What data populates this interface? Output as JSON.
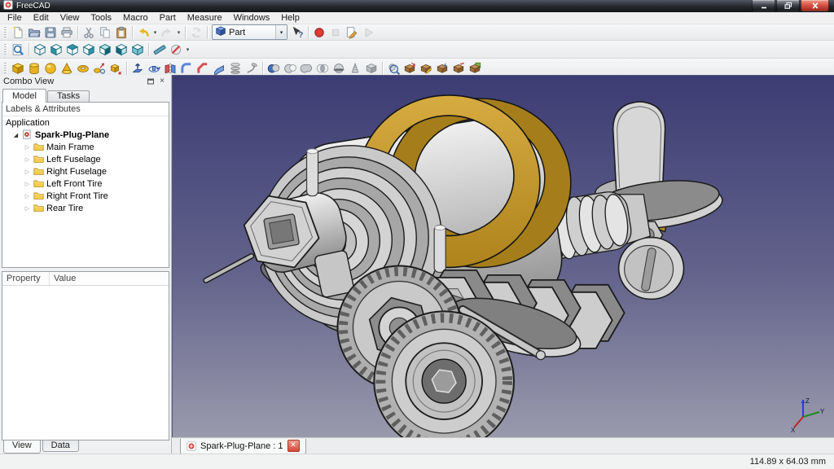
{
  "window": {
    "title": "FreeCAD",
    "controls": {
      "minimize": "minimize",
      "restore": "restore",
      "close": "close"
    }
  },
  "menu_bar": {
    "items": [
      "File",
      "Edit",
      "View",
      "Tools",
      "Macro",
      "Part",
      "Measure",
      "Windows",
      "Help"
    ]
  },
  "workbench_selector": {
    "value": "Part",
    "icon": "workbench-part"
  },
  "toolbars": {
    "standard": [
      [
        {
          "icon": "new-file"
        },
        {
          "icon": "open-file"
        },
        {
          "icon": "save-file"
        },
        {
          "icon": "print"
        }
      ],
      [
        {
          "icon": "cut"
        },
        {
          "icon": "copy"
        },
        {
          "icon": "paste"
        }
      ],
      [
        {
          "icon": "undo",
          "caret": true
        },
        {
          "icon": "redo",
          "caret": true,
          "disabled": true
        }
      ],
      [
        {
          "icon": "refresh",
          "disabled": true
        }
      ],
      [
        {
          "combo": true,
          "icon": "workbench-part"
        },
        {
          "icon": "whats-this"
        }
      ],
      [
        {
          "icon": "record-macro"
        },
        {
          "icon": "stop-macro",
          "disabled": true
        },
        {
          "icon": "edit-macro"
        },
        {
          "icon": "run-macro",
          "disabled": true
        }
      ]
    ],
    "view": [
      [
        {
          "icon": "fit-all"
        }
      ],
      [
        {
          "icon": "view-axonometric"
        },
        {
          "icon": "view-front"
        },
        {
          "icon": "view-top"
        },
        {
          "icon": "view-right"
        },
        {
          "icon": "view-rear"
        },
        {
          "icon": "view-bottom"
        },
        {
          "icon": "view-left"
        }
      ],
      [
        {
          "icon": "measure-distance"
        },
        {
          "icon": "clear-measurement",
          "caret": true
        }
      ]
    ],
    "part": [
      [
        {
          "icon": "primitive-box"
        },
        {
          "icon": "primitive-cylinder"
        },
        {
          "icon": "primitive-sphere"
        },
        {
          "icon": "primitive-cone"
        },
        {
          "icon": "primitive-torus"
        },
        {
          "icon": "create-primitives"
        },
        {
          "icon": "shape-builder"
        }
      ],
      [
        {
          "icon": "extrude"
        },
        {
          "icon": "revolve"
        },
        {
          "icon": "mirror"
        },
        {
          "icon": "fillet"
        },
        {
          "icon": "chamfer"
        },
        {
          "icon": "ruled-surface"
        },
        {
          "icon": "loft"
        },
        {
          "icon": "sweep"
        }
      ],
      [
        {
          "icon": "boolean"
        },
        {
          "icon": "boolean-cut"
        },
        {
          "icon": "boolean-union"
        },
        {
          "icon": "boolean-intersection"
        },
        {
          "icon": "section"
        },
        {
          "icon": "cross-sections"
        },
        {
          "icon": "compound"
        }
      ],
      [
        {
          "icon": "check-geometry"
        },
        {
          "icon": "defeaturing"
        },
        {
          "icon": "edit-shape"
        },
        {
          "icon": "refine-shape"
        },
        {
          "icon": "reverse-shapes"
        },
        {
          "icon": "convert-to-solid"
        }
      ]
    ]
  },
  "combo_view": {
    "title": "Combo View",
    "tabs": [
      {
        "label": "Model",
        "active": true
      },
      {
        "label": "Tasks",
        "active": false
      }
    ],
    "tree_header": "Labels & Attributes",
    "tree": {
      "root": "Application",
      "document": {
        "label": "Spark-Plug-Plane",
        "children": [
          "Main Frame",
          "Left Fuselage",
          "Right Fuselage",
          "Left Front Tire",
          "Right Front Tire",
          "Rear Tire"
        ]
      }
    },
    "property_table": {
      "columns": [
        "Property",
        "Value"
      ],
      "rows": []
    },
    "bottom_tabs": [
      {
        "label": "View",
        "active": true
      },
      {
        "label": "Data",
        "active": false
      }
    ]
  },
  "viewport": {
    "document_tab": {
      "label": "Spark-Plug-Plane : 1"
    },
    "axis_labels": {
      "x": "X",
      "y": "Y",
      "z": "Z"
    },
    "background_top": "#3c3c74",
    "background_bottom": "#9a9aad",
    "model_name": "spark-plug-plane-3d-model",
    "accent_gold": "#c49a32"
  },
  "status_bar": {
    "dimensions": "114.89 x 64.03 mm"
  }
}
